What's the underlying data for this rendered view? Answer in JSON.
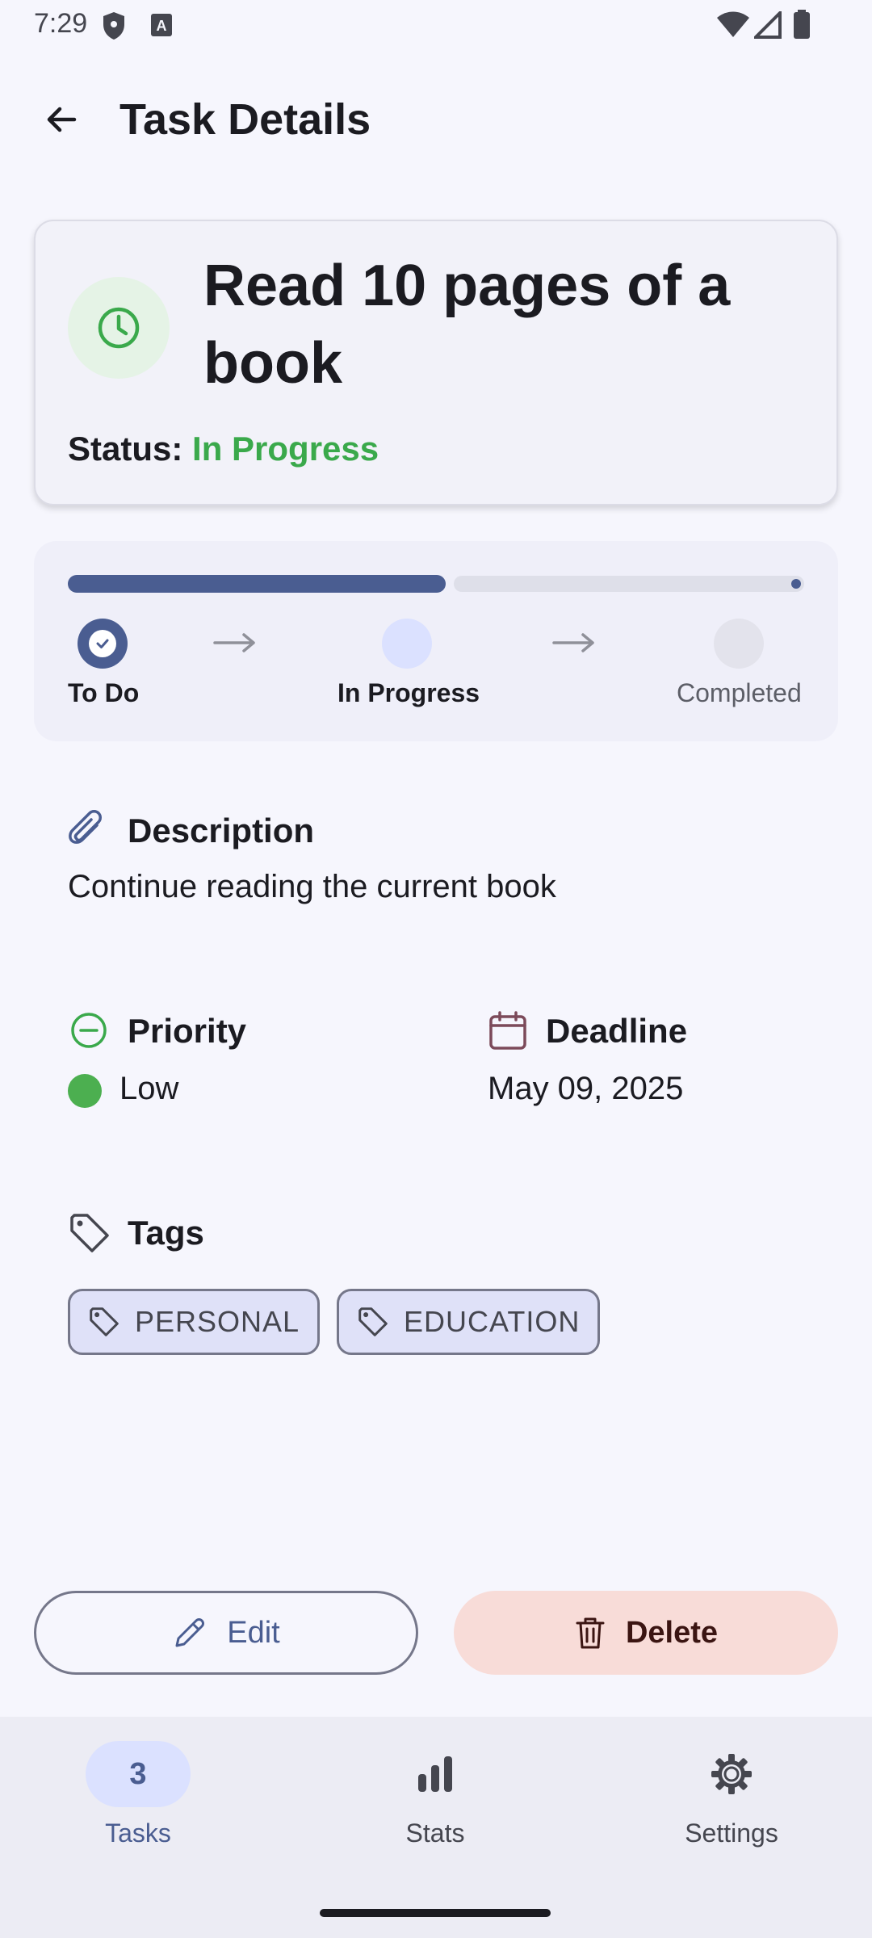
{
  "status_bar": {
    "time": "7:29"
  },
  "app_bar": {
    "title": "Task Details"
  },
  "task": {
    "title": "Read 10 pages of a book",
    "status_label": "Status:",
    "status_value": "In Progress"
  },
  "progress": {
    "fraction": 0.5,
    "steps": [
      {
        "label": "To Do",
        "state": "done"
      },
      {
        "label": "In Progress",
        "state": "current"
      },
      {
        "label": "Completed",
        "state": "pending"
      }
    ]
  },
  "description": {
    "heading": "Description",
    "text": "Continue reading the current book"
  },
  "priority": {
    "heading": "Priority",
    "value": "Low",
    "color": "#4caf50"
  },
  "deadline": {
    "heading": "Deadline",
    "value": "May 09, 2025"
  },
  "tags": {
    "heading": "Tags",
    "items": [
      "PERSONAL",
      "EDUCATION"
    ]
  },
  "actions": {
    "edit": "Edit",
    "delete": "Delete"
  },
  "nav": {
    "tasks": {
      "label": "Tasks",
      "badge": "3"
    },
    "stats": {
      "label": "Stats"
    },
    "settings": {
      "label": "Settings"
    }
  },
  "colors": {
    "accent": "#4a5d91",
    "success": "#3aa94b",
    "danger_bg": "#f8dcd8"
  },
  "icons": {
    "status_bar": [
      "shield-icon",
      "keyboard-a-icon",
      "wifi-icon",
      "cellular-icon",
      "battery-icon"
    ],
    "app": [
      "back-arrow-icon",
      "clock-icon",
      "check-icon",
      "arrow-right-icon",
      "paperclip-icon",
      "minus-circle-icon",
      "calendar-icon",
      "tag-icon",
      "pencil-icon",
      "trash-icon",
      "bar-chart-icon",
      "gear-icon"
    ]
  }
}
